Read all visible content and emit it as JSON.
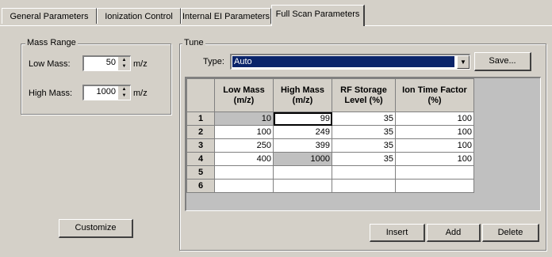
{
  "tabs": [
    {
      "label": "General Parameters"
    },
    {
      "label": "Ionization Control"
    },
    {
      "label": "Internal EI Parameters"
    },
    {
      "label": "Full Scan Parameters"
    }
  ],
  "mass_range": {
    "legend": "Mass Range",
    "low_label": "Low Mass:",
    "low_value": "50",
    "low_unit": "m/z",
    "high_label": "High Mass:",
    "high_value": "1000",
    "high_unit": "m/z"
  },
  "customize_label": "Customize",
  "tune": {
    "legend": "Tune",
    "type_label": "Type:",
    "type_value": "Auto",
    "save_label": "Save...",
    "columns": [
      "Low Mass (m/z)",
      "High Mass (m/z)",
      "RF Storage Level (%)",
      "Ion Time Factor (%)"
    ],
    "rows": [
      {
        "num": "1",
        "low": "10",
        "high": "99",
        "rf": "35",
        "ion": "100"
      },
      {
        "num": "2",
        "low": "100",
        "high": "249",
        "rf": "35",
        "ion": "100"
      },
      {
        "num": "3",
        "low": "250",
        "high": "399",
        "rf": "35",
        "ion": "100"
      },
      {
        "num": "4",
        "low": "400",
        "high": "1000",
        "rf": "35",
        "ion": "100"
      },
      {
        "num": "5",
        "low": "",
        "high": "",
        "rf": "",
        "ion": ""
      },
      {
        "num": "6",
        "low": "",
        "high": "",
        "rf": "",
        "ion": ""
      }
    ],
    "insert_label": "Insert",
    "add_label": "Add",
    "delete_label": "Delete"
  }
}
